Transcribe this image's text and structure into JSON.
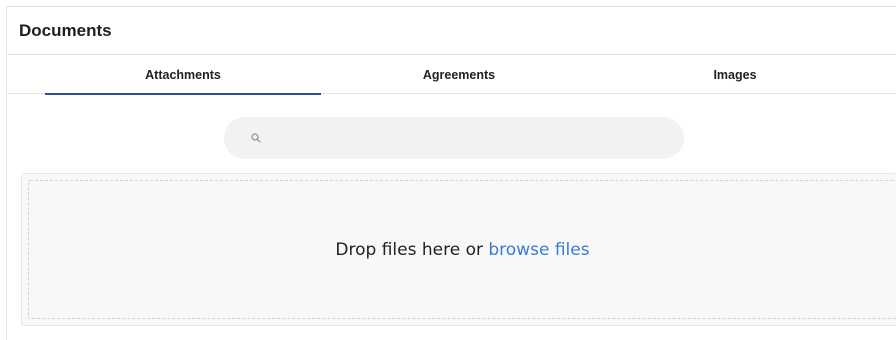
{
  "panel": {
    "title": "Documents"
  },
  "tabs": [
    {
      "label": "Attachments",
      "active": true
    },
    {
      "label": "Agreements",
      "active": false
    },
    {
      "label": "Images",
      "active": false
    }
  ],
  "search": {
    "icon": "search-icon",
    "value": "",
    "placeholder": ""
  },
  "dropzone": {
    "prompt": "Drop files here or",
    "link_label": "browse files"
  },
  "colors": {
    "accent": "#2e4e9c",
    "link": "#3b7bd6",
    "search_bg": "#f2f2f2",
    "dropzone_bg": "#f8f8f8"
  }
}
